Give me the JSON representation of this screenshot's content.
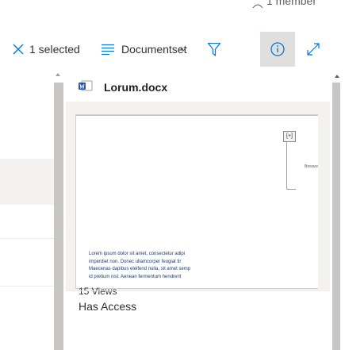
{
  "header": {
    "member_text": "1 member"
  },
  "command_bar": {
    "selection_label": "1 selected",
    "view_label": "Documentset",
    "icons": {
      "close": "close-icon",
      "view": "list-view-icon",
      "chevron": "chevron-down-icon",
      "filter": "filter-icon",
      "info": "info-icon",
      "expand": "expand-icon"
    },
    "colors": {
      "accent": "#0078d4",
      "active_bg": "#e1dfdd"
    }
  },
  "details": {
    "file_name": "Lorum.docx",
    "file_icon": "word-document-icon",
    "views_label": "15 Views",
    "access_label": "Has Access",
    "preview": {
      "tab_label": "[+]",
      "note": "Beware",
      "lines": [
        "Lorem ipsum dolor sit amet, consectetur adipi",
        "imperdiet non. Donec ullamcorper feugiat tir",
        "Maecenas dapibus eleifend nulla, sit amet semp",
        "id pretium nisl. Aenean fermentum hendrerit"
      ]
    }
  }
}
